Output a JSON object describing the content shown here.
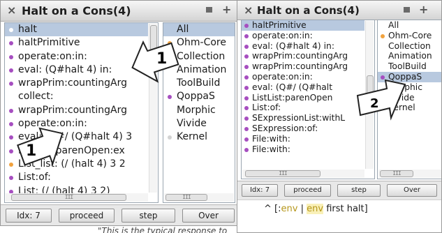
{
  "left_window": {
    "title": "Halt on a Cons(4)",
    "close_glyph": "×",
    "menu_glyph": "+",
    "stack": [
      {
        "label": "halt",
        "dot": "light",
        "selected": true
      },
      {
        "label": "haltPrimitive",
        "dot": "purple"
      },
      {
        "label": "operate:on:in:",
        "dot": "purple"
      },
      {
        "label": "eval: (Q#halt 4) in:",
        "dot": "purple"
      },
      {
        "label": "wrapPrim:countingArg",
        "dot": "purple"
      },
      {
        "label": "collect:",
        "dot": "none"
      },
      {
        "label": "wrapPrim:countingArg",
        "dot": "purple"
      },
      {
        "label": "operate:on:in:",
        "dot": "purple"
      },
      {
        "label": "eval: (Q#/ (Q#halt 4) 3",
        "dot": "purple"
      },
      {
        "label": "ListList:parenOpen:ex",
        "dot": "purple"
      },
      {
        "label": "List_list: (/ (halt 4) 3 2",
        "dot": "orange"
      },
      {
        "label": "List:of:",
        "dot": "purple"
      },
      {
        "label": "List: (/ (halt 4) 3 2)",
        "dot": "purple"
      }
    ],
    "classes": [
      {
        "label": "All",
        "dot": "none",
        "selected": true
      },
      {
        "label": "Ohm-Core",
        "dot": "orange"
      },
      {
        "label": "Collection",
        "dot": "none"
      },
      {
        "label": "Animation",
        "dot": "none"
      },
      {
        "label": "ToolBuild",
        "dot": "none"
      },
      {
        "label": "QoppaS",
        "dot": "purple"
      },
      {
        "label": "Morphic",
        "dot": "none"
      },
      {
        "label": "Vivide",
        "dot": "none"
      },
      {
        "label": "Kernel",
        "dot": "grey"
      }
    ],
    "buttons": {
      "idx": "Idx: 7",
      "proceed": "proceed",
      "step": "step",
      "over": "Over"
    },
    "scrollbar_glyph": "III",
    "callout_top": "1",
    "callout_bottom": "1"
  },
  "right_window": {
    "title": "Halt on a Cons(4)",
    "close_glyph": "×",
    "menu_glyph": "+",
    "stack": [
      {
        "label": "haltPrimitive",
        "dot": "purple",
        "selected": true
      },
      {
        "label": "operate:on:in:",
        "dot": "purple"
      },
      {
        "label": "eval: (Q#halt 4) in:",
        "dot": "purple"
      },
      {
        "label": "wrapPrim:countingArg",
        "dot": "purple"
      },
      {
        "label": "wrapPrim:countingArg",
        "dot": "purple"
      },
      {
        "label": "operate:on:in:",
        "dot": "purple"
      },
      {
        "label": "eval: (Q#/ (Q#halt",
        "dot": "purple"
      },
      {
        "label": "ListList:parenOpen",
        "dot": "purple"
      },
      {
        "label": "List:of:",
        "dot": "purple"
      },
      {
        "label": "SExpressionList:withL",
        "dot": "purple"
      },
      {
        "label": "SExpression:of:",
        "dot": "purple"
      },
      {
        "label": "File:with:",
        "dot": "purple"
      },
      {
        "label": "File:with:",
        "dot": "purple"
      }
    ],
    "classes": [
      {
        "label": "All",
        "dot": "none"
      },
      {
        "label": "Ohm-Core",
        "dot": "orange"
      },
      {
        "label": "Collection",
        "dot": "none"
      },
      {
        "label": "Animation",
        "dot": "none"
      },
      {
        "label": "ToolBuild",
        "dot": "none"
      },
      {
        "label": "QoppaS",
        "dot": "purple",
        "selected": true
      },
      {
        "label": "Morphic",
        "dot": "none"
      },
      {
        "label": "Vivide",
        "dot": "none"
      },
      {
        "label": "Kernel",
        "dot": "grey"
      }
    ],
    "buttons": {
      "idx": "Idx: 7",
      "proceed": "proceed",
      "step": "step",
      "over": "Over"
    },
    "scrollbar_glyph": "III",
    "code": {
      "caret": "^",
      "open": "[:",
      "env1": "env",
      "bar": "|",
      "env2": "env",
      "rest": "first halt]"
    },
    "callout": "2"
  },
  "bottom_caption": "\"This is the typical response to"
}
